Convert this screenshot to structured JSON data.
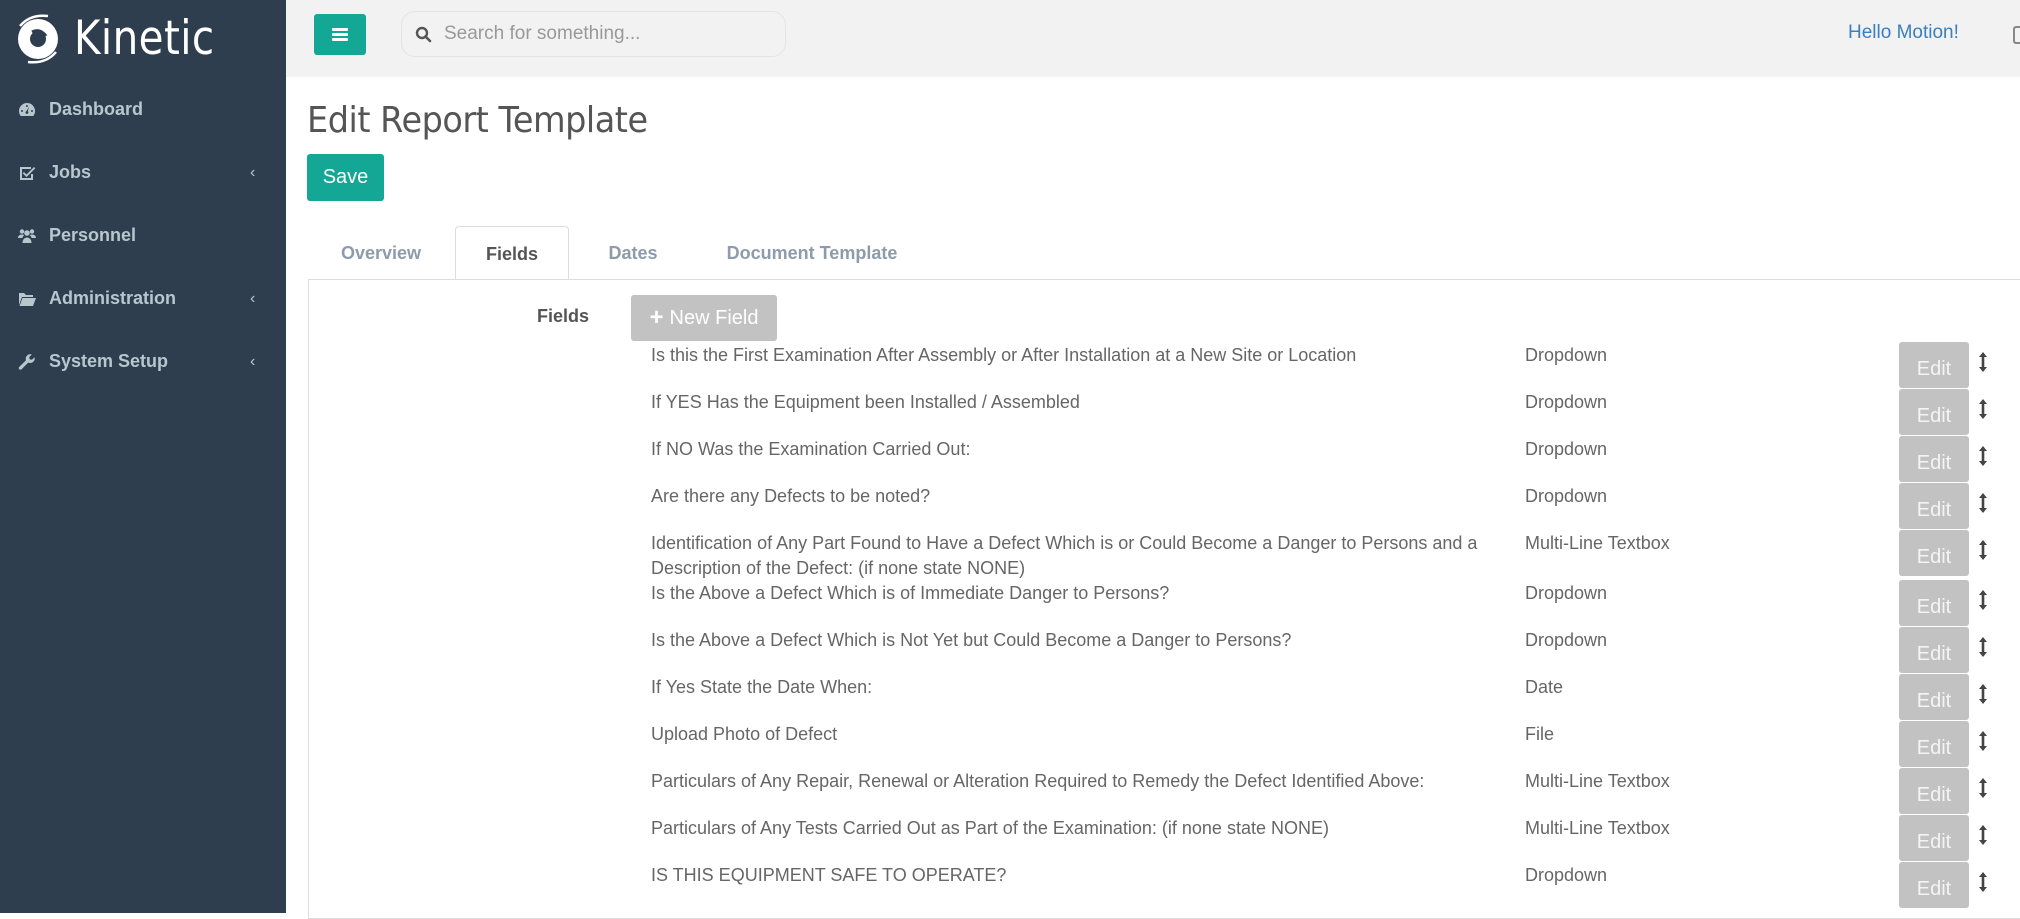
{
  "app": {
    "brand": "Kinetic"
  },
  "sidebar": {
    "items": [
      {
        "label": "Dashboard",
        "icon": "dashboard-icon",
        "has_submenu": false
      },
      {
        "label": "Jobs",
        "icon": "check-square-icon",
        "has_submenu": true
      },
      {
        "label": "Personnel",
        "icon": "users-icon",
        "has_submenu": false
      },
      {
        "label": "Administration",
        "icon": "folder-open-icon",
        "has_submenu": true
      },
      {
        "label": "System Setup",
        "icon": "wrench-icon",
        "has_submenu": true
      }
    ],
    "chevron": "‹"
  },
  "header": {
    "search_placeholder": "Search for something...",
    "search_value": "",
    "greeting": "Hello Motion!"
  },
  "page": {
    "title": "Edit Report Template",
    "save_label": "Save"
  },
  "tabs": [
    {
      "label": "Overview",
      "active": false
    },
    {
      "label": "Fields",
      "active": true
    },
    {
      "label": "Dates",
      "active": false
    },
    {
      "label": "Document Template",
      "active": false
    }
  ],
  "fields_section": {
    "label": "Fields",
    "new_field_label": "New Field",
    "edit_label": "Edit",
    "rows": [
      {
        "name": "Is this the First Examination After Assembly or After Installation at a New Site or Location",
        "type": "Dropdown"
      },
      {
        "name": "If YES Has the Equipment been Installed / Assembled",
        "type": "Dropdown"
      },
      {
        "name": "If NO Was the Examination Carried Out:",
        "type": "Dropdown"
      },
      {
        "name": "Are there any Defects to be noted?",
        "type": "Dropdown"
      },
      {
        "name": "Identification of Any Part Found to Have a Defect Which is or Could Become a Danger to Persons and a Description of the Defect: (if none state NONE)",
        "type": "Multi-Line Textbox"
      },
      {
        "name": "Is the Above a Defect Which is of Immediate Danger to Persons?",
        "type": "Dropdown"
      },
      {
        "name": "Is the Above a Defect Which is Not Yet but Could Become a Danger to Persons?",
        "type": "Dropdown"
      },
      {
        "name": "If Yes State the Date When:",
        "type": "Date"
      },
      {
        "name": "Upload Photo of Defect",
        "type": "File"
      },
      {
        "name": "Particulars of Any Repair, Renewal or Alteration Required to Remedy the Defect Identified Above:",
        "type": "Multi-Line Textbox"
      },
      {
        "name": "Particulars of Any Tests Carried Out as Part of the Examination: (if none state NONE)",
        "type": "Multi-Line Textbox"
      },
      {
        "name": "IS THIS EQUIPMENT SAFE TO OPERATE?",
        "type": "Dropdown"
      }
    ]
  },
  "colors": {
    "sidebar_bg": "#2f3e4e",
    "accent": "#15a796",
    "header_bg": "#f2f2f2",
    "disabled_button": "#c2c2c2",
    "link": "#3c7ebd"
  }
}
